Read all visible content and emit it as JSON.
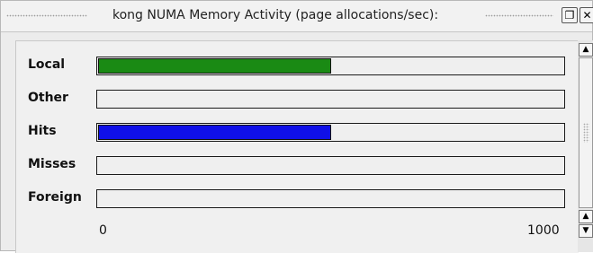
{
  "window": {
    "title": "kong NUMA Memory Activity (page allocations/sec):",
    "float_icon": "restore-icon",
    "close_icon": "close-icon"
  },
  "chart_data": {
    "type": "bar",
    "orientation": "horizontal",
    "categories": [
      "Local",
      "Other",
      "Hits",
      "Misses",
      "Foreign"
    ],
    "values": [
      500,
      0,
      500,
      0,
      0
    ],
    "colors": [
      "#1a8a14",
      null,
      "#1010e8",
      null,
      null
    ],
    "xlim": [
      0,
      1000
    ],
    "x_tick_labels": [
      "0",
      "1000"
    ],
    "title": "kong NUMA Memory Activity (page allocations/sec):",
    "grid": false
  },
  "scrollbar": {
    "up_icon": "arrow-up-icon",
    "down_icon": "arrow-down-icon"
  }
}
